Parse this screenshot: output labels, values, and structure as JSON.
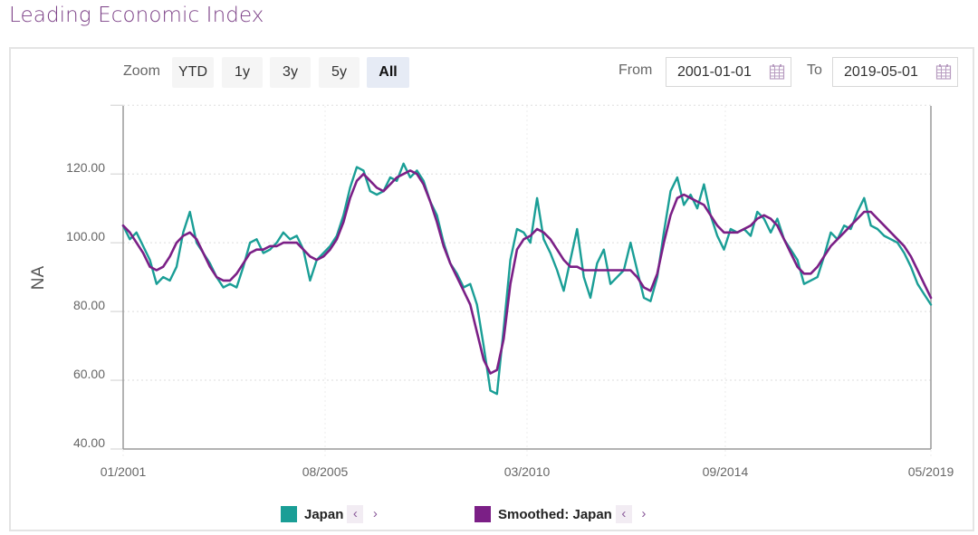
{
  "page": {
    "title": "Leading Economic Index"
  },
  "toolbar": {
    "zoom_label": "Zoom",
    "zoom_buttons": [
      {
        "label": "YTD",
        "active": false
      },
      {
        "label": "1y",
        "active": false
      },
      {
        "label": "3y",
        "active": false
      },
      {
        "label": "5y",
        "active": false
      },
      {
        "label": "All",
        "active": true
      }
    ],
    "from_label": "From",
    "from_value": "2001-01-01",
    "to_label": "To",
    "to_value": "2019-05-01",
    "calendar_icon": "calendar-icon"
  },
  "legend": {
    "items": [
      {
        "name": "Japan",
        "color": "#1a9e96",
        "prev_icon": "chevron-left-icon",
        "next_icon": "chevron-right-icon"
      },
      {
        "name": "Smoothed: Japan",
        "color": "#7b1f86",
        "prev_icon": "chevron-left-icon",
        "next_icon": "chevron-right-icon"
      }
    ]
  },
  "chart_data": {
    "type": "line",
    "title": "Leading Economic Index",
    "xlabel": "",
    "ylabel": "NA",
    "ylim": [
      40,
      140
    ],
    "yticks": [
      40,
      60,
      80,
      100,
      120
    ],
    "ytick_labels": [
      "40.00",
      "60.00",
      "80.00",
      "100.00",
      "120.00"
    ],
    "x_start": "2001-01",
    "x_end": "2019-05",
    "x_step_months": 2,
    "xtick_labels": [
      {
        "label": "01/2001",
        "month_index": 0
      },
      {
        "label": "08/2005",
        "month_index": 55
      },
      {
        "label": "03/2010",
        "month_index": 110
      },
      {
        "label": "09/2014",
        "month_index": 164
      },
      {
        "label": "05/2019",
        "month_index": 220
      }
    ],
    "grid": true,
    "legend_position": "bottom",
    "series": [
      {
        "name": "Japan",
        "color": "#1a9e96",
        "values": [
          105,
          101,
          103,
          99,
          95,
          88,
          90,
          89,
          93,
          103,
          109,
          100,
          97,
          94,
          90,
          87,
          88,
          87,
          93,
          100,
          101,
          97,
          98,
          100,
          103,
          101,
          102,
          98,
          89,
          95,
          97,
          99,
          102,
          108,
          116,
          122,
          121,
          115,
          114,
          115,
          119,
          118,
          123,
          119,
          121,
          118,
          112,
          108,
          100,
          94,
          91,
          87,
          88,
          82,
          70,
          57,
          56,
          75,
          95,
          104,
          103,
          100,
          113,
          101,
          97,
          92,
          86,
          95,
          104,
          90,
          84,
          94,
          98,
          88,
          90,
          92,
          100,
          92,
          84,
          83,
          90,
          103,
          115,
          119,
          111,
          114,
          110,
          117,
          108,
          102,
          98,
          104,
          103,
          104,
          102,
          109,
          107,
          103,
          107,
          101,
          98,
          95,
          88,
          89,
          90,
          96,
          103,
          101,
          105,
          104,
          109,
          113,
          105,
          104,
          102,
          101,
          100,
          97,
          93,
          88,
          85,
          82
        ]
      },
      {
        "name": "Smoothed: Japan",
        "color": "#7b1f86",
        "values": [
          105,
          103,
          100,
          97,
          93,
          92,
          93,
          96,
          100,
          102,
          103,
          101,
          97,
          93,
          90,
          89,
          89,
          91,
          94,
          97,
          98,
          98,
          99,
          99,
          100,
          100,
          100,
          98,
          96,
          95,
          96,
          98,
          101,
          106,
          113,
          118,
          120,
          118,
          116,
          115,
          117,
          119,
          120,
          121,
          120,
          117,
          112,
          106,
          99,
          94,
          90,
          86,
          82,
          74,
          66,
          62,
          63,
          72,
          88,
          98,
          101,
          102,
          104,
          103,
          101,
          98,
          95,
          93,
          93,
          92,
          92,
          92,
          92,
          92,
          92,
          92,
          92,
          90,
          87,
          86,
          91,
          100,
          108,
          113,
          114,
          113,
          112,
          111,
          108,
          105,
          103,
          103,
          103,
          104,
          105,
          107,
          108,
          107,
          105,
          101,
          97,
          93,
          91,
          91,
          93,
          96,
          99,
          101,
          103,
          105,
          107,
          109,
          109,
          107,
          105,
          103,
          101,
          99,
          96,
          92,
          88,
          84
        ]
      }
    ]
  }
}
